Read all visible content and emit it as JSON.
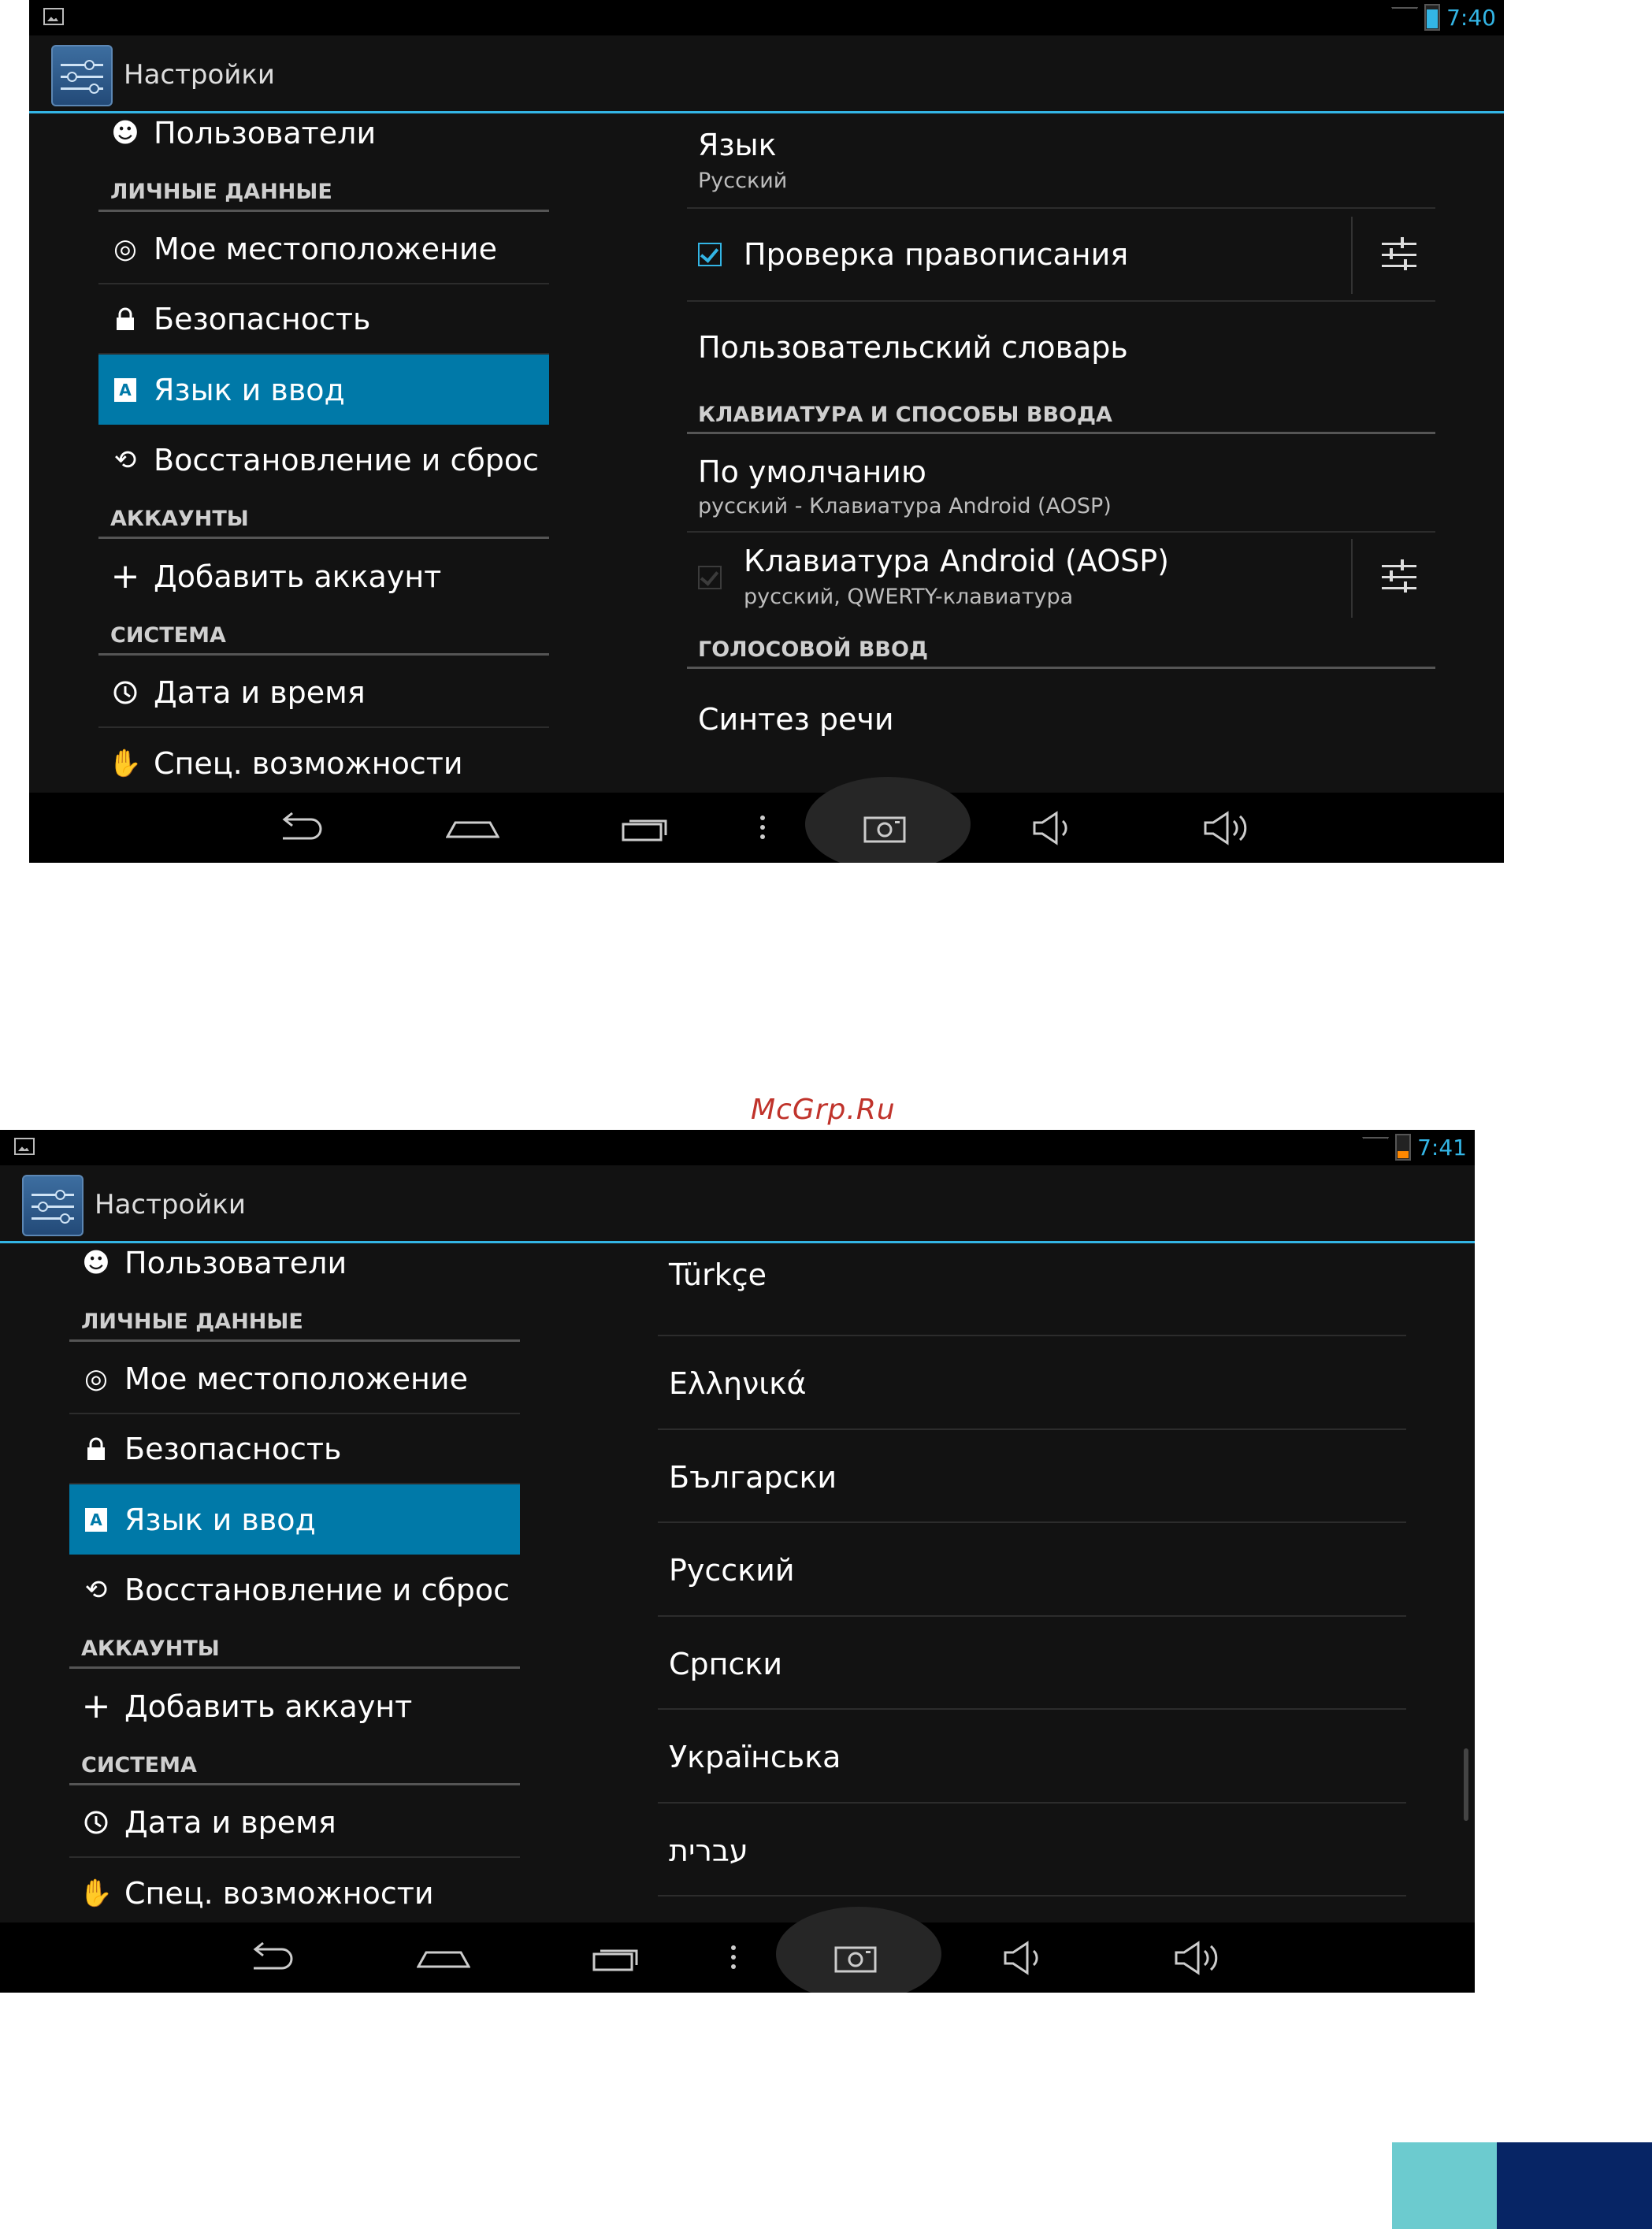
{
  "screenshot1": {
    "status": {
      "time": "7:40"
    },
    "app_title": "Настройки",
    "sidebar": {
      "item_users": "Пользователи",
      "header_personal": "ЛИЧНЫЕ ДАННЫЕ",
      "item_location": "Мое местоположение",
      "item_security": "Безопасность",
      "item_language": "Язык и ввод",
      "item_backup": "Восстановление и сброс",
      "header_accounts": "АККАУНТЫ",
      "item_add_account": "Добавить аккаунт",
      "header_system": "СИСТЕМА",
      "item_datetime": "Дата и время",
      "item_accessibility": "Спец. возможности"
    },
    "settings": {
      "language_title": "Язык",
      "language_value": "Русский",
      "spellcheck_label": "Проверка правописания",
      "user_dictionary": "Пользовательский словарь",
      "header_keyboard": "КЛАВИАТУРА И СПОСОБЫ ВВОДА",
      "default_title": "По умолчанию",
      "default_value": "русский - Клавиатура Android (AOSP)",
      "keyboard_title": "Клавиатура Android (AOSP)",
      "keyboard_value": "русский, QWERTY-клавиатура",
      "header_voice": "ГОЛОСОВОЙ ВВОД",
      "tts": "Синтез речи"
    }
  },
  "watermark": "McGrp.Ru",
  "screenshot2": {
    "status": {
      "time": "7:41"
    },
    "app_title": "Настройки",
    "sidebar": {
      "item_users": "Пользователи",
      "header_personal": "ЛИЧНЫЕ ДАННЫЕ",
      "item_location": "Мое местоположение",
      "item_security": "Безопасность",
      "item_language": "Язык и ввод",
      "item_backup": "Восстановление и сброс",
      "header_accounts": "АККАУНТЫ",
      "item_add_account": "Добавить аккаунт",
      "header_system": "СИСТЕМА",
      "item_datetime": "Дата и время",
      "item_accessibility": "Спец. возможности"
    },
    "languages": [
      "Türkçe",
      "Ελληνικά",
      "Български",
      "Русский",
      "Српски",
      "Українська",
      "עברית"
    ]
  },
  "colors": {
    "accent": "#33b5e5",
    "selected": "#0079a8",
    "background": "#121212",
    "corner_light": "#6ccbcf",
    "corner_dark": "#072565"
  },
  "icons": [
    "image-icon",
    "wifi-icon",
    "battery-icon",
    "settings-app-icon",
    "user-icon",
    "location-icon",
    "lock-icon",
    "language-icon",
    "restore-icon",
    "plus-icon",
    "clock-icon",
    "hand-icon",
    "checkbox-icon",
    "tune-icon",
    "back-icon",
    "home-icon",
    "recent-apps-icon",
    "menu-icon",
    "screenshot-icon",
    "volume-down-icon",
    "volume-up-icon"
  ]
}
